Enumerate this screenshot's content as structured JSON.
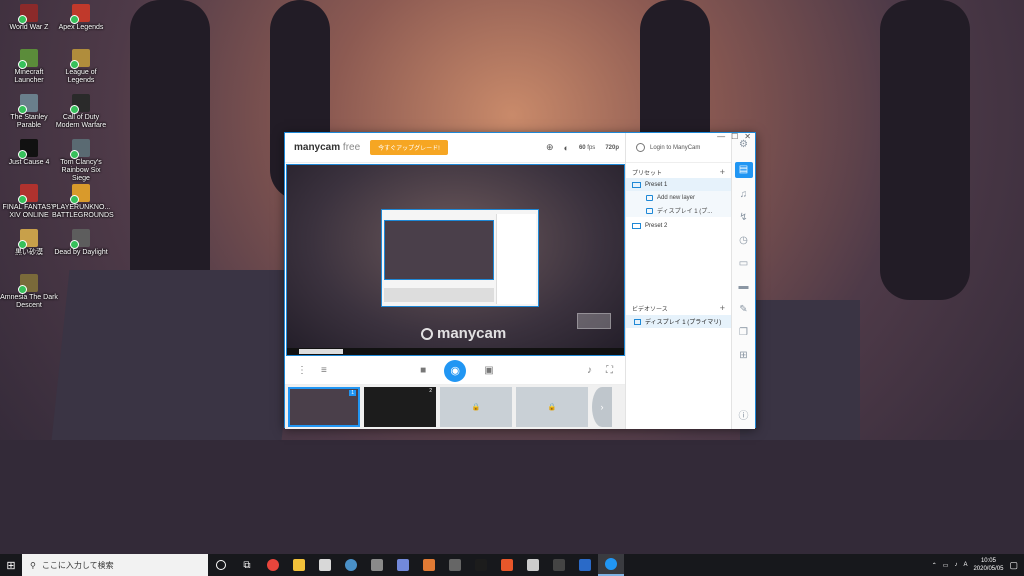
{
  "desktop": {
    "icons": [
      {
        "label": "World War Z",
        "color": "#8b2a2a"
      },
      {
        "label": "Apex Legends",
        "color": "#c0392b"
      },
      {
        "label": "Minecraft Launcher",
        "color": "#5b8c3a"
      },
      {
        "label": "League of Legends",
        "color": "#b08d3c"
      },
      {
        "label": "The Stanley Parable",
        "color": "#6a7f8c"
      },
      {
        "label": "Call of Duty Modern Warfare",
        "color": "#2a2a2a"
      },
      {
        "label": "Just Cause 4",
        "color": "#111111"
      },
      {
        "label": "Tom Clancy's Rainbow Six Siege",
        "color": "#5a6a72"
      },
      {
        "label": "FINAL FANTASY XIV ONLINE",
        "color": "#b0322e"
      },
      {
        "label": "PLAYERUNKNO... BATTLEGROUNDS",
        "color": "#d99a2b"
      },
      {
        "label": "黒い砂漠",
        "color": "#c8a04a"
      },
      {
        "label": "Dead by Daylight",
        "color": "#5d5d5d"
      },
      {
        "label": "Amnesia The Dark Descent",
        "color": "#7a6a3a"
      }
    ]
  },
  "window": {
    "logo_main": "manycam",
    "logo_sub": " free",
    "upgrade_label": "今すぐアップグレード!",
    "fps_value": "60",
    "fps_unit": "fps",
    "resolution": "720p",
    "watermark": "manycam",
    "login_label": "Login to ManyCam",
    "presets_title": "プリセット",
    "presets": [
      {
        "name": "Preset 1"
      },
      {
        "name": "Preset 2"
      }
    ],
    "layers": [
      {
        "name": "Add new layer"
      },
      {
        "name": "ディスプレイ 1 (プ..."
      }
    ],
    "video_sources_title": "ビデオソース",
    "video_source": "ディスプレイ 1 (プライマリ)",
    "thumbs": [
      {
        "num": "1"
      },
      {
        "num": "2"
      }
    ]
  },
  "taskbar": {
    "search_placeholder": "ここに入力して検索",
    "time": "10:05",
    "date": "2020/05/05",
    "apps": [
      {
        "name": "chrome",
        "color": "#e8453c"
      },
      {
        "name": "explorer",
        "color": "#f3c13a"
      },
      {
        "name": "store",
        "color": "#d8d8d8"
      },
      {
        "name": "steam",
        "color": "#4a90c8"
      },
      {
        "name": "app-5",
        "color": "#8a8a8a"
      },
      {
        "name": "discord",
        "color": "#7289da"
      },
      {
        "name": "app-7",
        "color": "#e07a34"
      },
      {
        "name": "app-8",
        "color": "#666666"
      },
      {
        "name": "app-9",
        "color": "#1c1c1c"
      },
      {
        "name": "app-10",
        "color": "#e8572a"
      },
      {
        "name": "app-11",
        "color": "#cccccc"
      },
      {
        "name": "film",
        "color": "#444444"
      },
      {
        "name": "app-13",
        "color": "#2a6ac8"
      },
      {
        "name": "manycam",
        "color": "#2196f3"
      }
    ]
  }
}
